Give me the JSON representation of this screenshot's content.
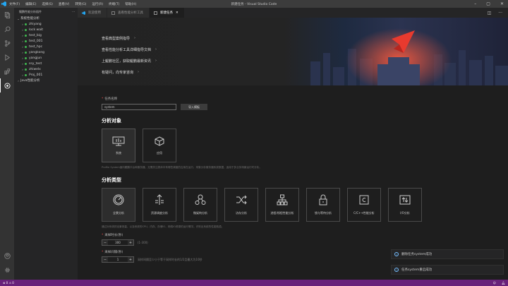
{
  "window": {
    "title": "新建任务 - Visual Studio Code",
    "menu": [
      "文件(F)",
      "编辑(E)",
      "选择(S)",
      "查看(V)",
      "转到(G)",
      "运行(R)",
      "终端(T)",
      "帮助(H)"
    ]
  },
  "sidebar": {
    "header": "鲲鹏性能分析插件",
    "tree": [
      {
        "label": "系统性能分析",
        "level": 0,
        "expanded": true,
        "dot": false
      },
      {
        "label": "zhiyang",
        "level": 1,
        "dot": true
      },
      {
        "label": "lock wait",
        "level": 1,
        "dot": true
      },
      {
        "label": "test_big",
        "level": 1,
        "dot": true
      },
      {
        "label": "test_001",
        "level": 1,
        "dot": true
      },
      {
        "label": "test_hpc",
        "level": 1,
        "dot": true
      },
      {
        "label": "yangkong",
        "level": 1,
        "dot": true
      },
      {
        "label": "yangjun",
        "level": 1,
        "dot": true
      },
      {
        "label": "ssy_test",
        "level": 1,
        "dot": true
      },
      {
        "label": "zhiwelx",
        "level": 1,
        "dot": true
      },
      {
        "label": "Proj_001",
        "level": 1,
        "dot": true
      },
      {
        "label": "Java性能分析",
        "level": 0,
        "expanded": false,
        "dot": false
      }
    ]
  },
  "tabs": [
    {
      "label": "欢迎使用",
      "active": false
    },
    {
      "label": "查看性能分析工具",
      "active": false
    },
    {
      "label": "新建任务",
      "active": true
    }
  ],
  "banner": {
    "links": [
      "查看典型案例指导",
      "查看性能分析工具详细指导文档",
      "上鲲鹏社区，获取鲲鹏最新资讯",
      "有疑问，向专家咨询"
    ]
  },
  "form": {
    "task_name_label": "任务名称",
    "task_name_value": "system",
    "import_button": "导入模板",
    "analysis_object_title": "分析对象",
    "analysis_objects": [
      {
        "label": "系统",
        "icon": "monitor-icon",
        "selected": true
      },
      {
        "label": "应用",
        "icon": "cube-icon",
        "selected": false
      }
    ],
    "object_desc": "Profile System面向鲲鹏平台和服务器、无需关注具体中有哪些调度的应用在运行，采集分析服务器系统数据，适用于多业务场景运行时分析。",
    "analysis_type_title": "分析类型",
    "analysis_types": [
      {
        "label": "全景分析",
        "icon": "gauge-icon",
        "selected": true
      },
      {
        "label": "资源调度分析",
        "icon": "arrows-icon",
        "selected": false
      },
      {
        "label": "微架构分析",
        "icon": "nodes-icon",
        "selected": false
      },
      {
        "label": "访存分析",
        "icon": "shuffle-icon",
        "selected": false
      },
      {
        "label": "进程/线程性能分析",
        "icon": "hierarchy-icon",
        "selected": false
      },
      {
        "label": "锁与等待分析",
        "icon": "lock-icon",
        "selected": false
      },
      {
        "label": "C/C++性能分析",
        "icon": "c-icon",
        "selected": false
      },
      {
        "label": "I/O分析",
        "icon": "io-icon",
        "selected": false
      }
    ],
    "type_desc": "通过对系统的全景测量，以及系统的CPU、内存、存储IO、网络IO资源的运行情况，识别出系统的性能瓶颈。",
    "duration_label": "采样时长(秒)",
    "duration_value": "300",
    "duration_hint": "(1-300)",
    "interval_label": "采样间隔(秒)",
    "interval_value": "1",
    "interval_hint": "采样间隔至少小于等于采样时长的1/2且最大为10秒"
  },
  "notifications": [
    "删除任务system成功",
    "任务system重启成功"
  ],
  "statusbar": {
    "left": "⊗ 0 ⚠ 0",
    "right": [
      "",
      ""
    ]
  },
  "colors": {
    "statusbar": "#68217a",
    "accent": "#3fb950",
    "required": "#f14c4c"
  }
}
